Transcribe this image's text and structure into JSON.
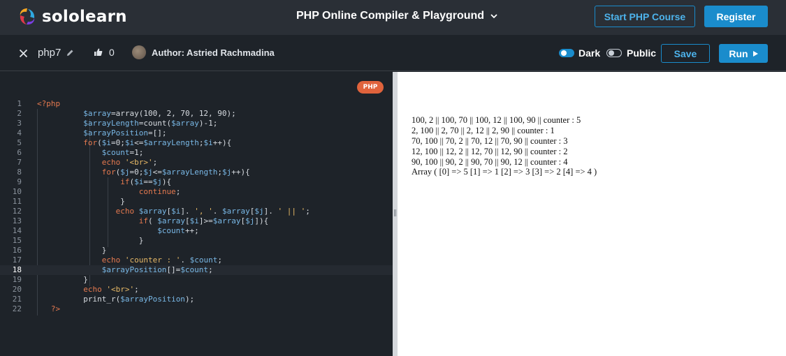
{
  "navbar": {
    "brand": "sololearn",
    "title": "PHP Online Compiler & Playground",
    "start_course": "Start PHP Course",
    "register": "Register"
  },
  "toolbar": {
    "code_name": "php7",
    "likes": "0",
    "author": "Author: Astried Rachmadina",
    "dark_label": "Dark",
    "dark_on": true,
    "public_label": "Public",
    "public_on": false,
    "save": "Save",
    "run": "Run"
  },
  "editor": {
    "language_badge": "PHP",
    "active_line": 18
  },
  "output": {
    "lines": [
      "100, 2 || 100, 70 || 100, 12 || 100, 90 || counter : 5",
      "2, 100 || 2, 70 || 2, 12 || 2, 90 || counter : 1",
      "70, 100 || 70, 2 || 70, 12 || 70, 90 || counter : 3",
      "12, 100 || 12, 2 || 12, 70 || 12, 90 || counter : 2",
      "90, 100 || 90, 2 || 90, 70 || 90, 12 || counter : 4",
      "Array ( [0] => 5 [1] => 1 [2] => 3 [3] => 2 [4] => 4 )"
    ]
  },
  "colors": {
    "accent": "#1a8ccc",
    "php_badge": "#e0633c",
    "keyword": "#e5794f",
    "variable": "#79b8e6",
    "string": "#e6b866"
  }
}
